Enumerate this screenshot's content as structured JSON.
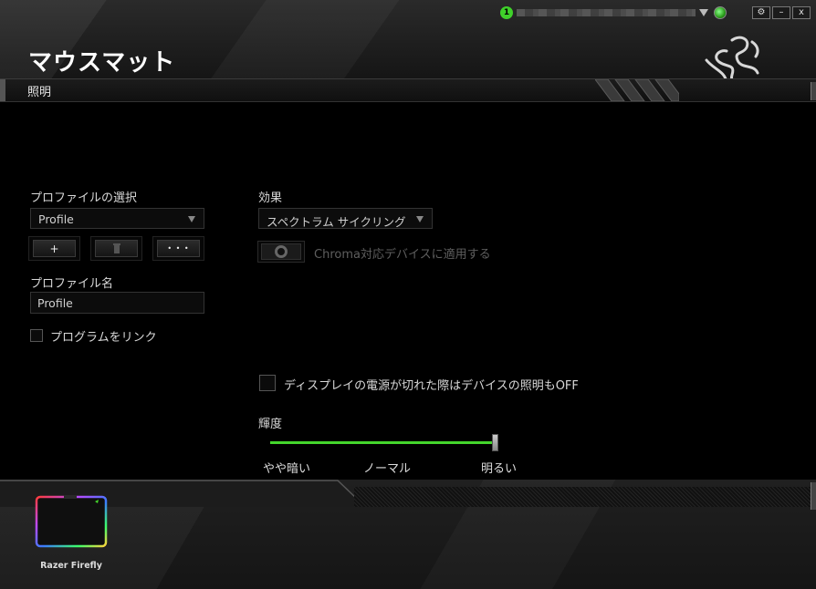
{
  "window": {
    "notification_count": "1",
    "settings_glyph": "⚙",
    "minimize_glyph": "–",
    "close_label": "x"
  },
  "header": {
    "title": "マウスマット",
    "active_tab": "照明"
  },
  "profile": {
    "select_label": "プロファイルの選択",
    "selected": "Profile",
    "add_label": "+",
    "delete_label": "🗑",
    "more_label": "• • •",
    "name_label": "プロファイル名",
    "name_value": "Profile",
    "link_program_label": "プログラムをリンク",
    "link_program_checked": false
  },
  "lighting": {
    "effect_label": "効果",
    "effect_selected": "スペクトラム サイクリング",
    "chroma_apply_label": "Chroma対応デバイスに適用する",
    "display_off_label": "ディスプレイの電源が切れた際はデバイスの照明もOFF",
    "display_off_checked": false,
    "brightness_label": "輝度",
    "brightness_value": 1.0,
    "brightness_ticks": [
      "やや暗い",
      "ノーマル",
      "明るい"
    ]
  },
  "devices": [
    {
      "name": "Razer Firefly"
    }
  ],
  "colors": {
    "accent": "#44d62c",
    "background": "#000000"
  }
}
